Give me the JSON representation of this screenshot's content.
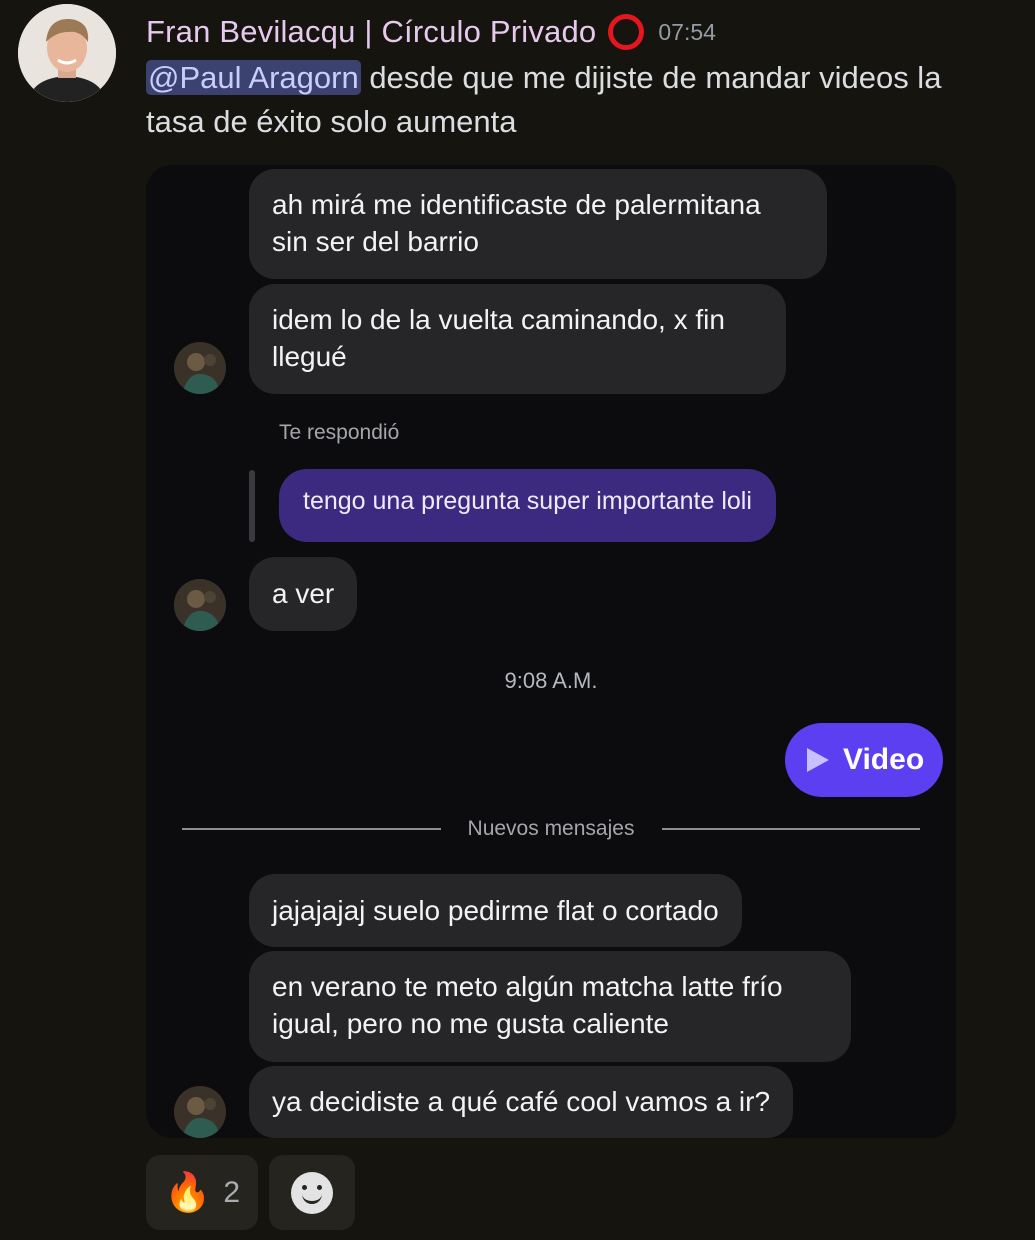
{
  "post": {
    "author": "Fran Bevilacqu | Círculo Privado",
    "time": "07:54",
    "mention": "@Paul Aragorn",
    "text": " desde que me dijiste de mandar videos la tasa de éxito solo aumenta"
  },
  "chat": {
    "messages": [
      "ah mirá me identificaste de palermitana sin ser del barrio",
      "idem lo de la vuelta caminando, x fin llegué",
      "a ver",
      "jajajajaj suelo pedirme flat o cortado",
      "en verano te meto algún matcha latte frío igual, pero no me gusta caliente",
      "ya decidiste a qué café cool vamos a ir?"
    ],
    "reply_label": "Te respondió",
    "reply_text": "tengo una pregunta super importante loli",
    "time_divider": "9:08 A.M.",
    "video_label": "Video",
    "new_messages_label": "Nuevos mensajes"
  },
  "reactions": {
    "fire_icon": "fire-icon",
    "fire_count": "2",
    "add_icon": "smiley-icon"
  },
  "colors": {
    "background": "#16140f",
    "author": "#e6c9ec",
    "mention_bg": "#3c4270",
    "card_bg": "#0c0c0f",
    "bubble_bg": "#262629",
    "reply_bubble": "#3c2a80",
    "video_button": "#5b3ff0",
    "status_ring": "#e4161f"
  }
}
